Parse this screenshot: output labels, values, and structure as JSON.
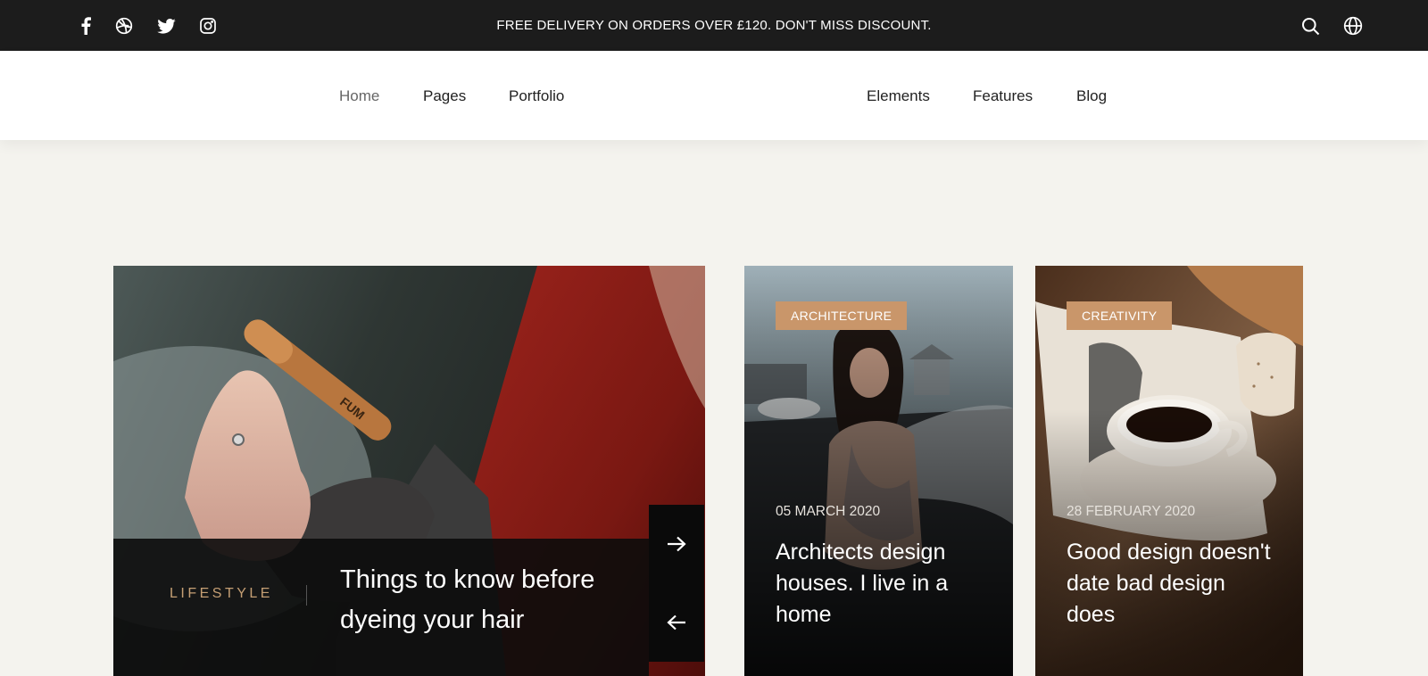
{
  "topbar": {
    "promo": "FREE DELIVERY ON ORDERS OVER £120. DON'T MISS DISCOUNT.",
    "social_icons": [
      "facebook-icon",
      "dribbble-icon",
      "twitter-icon",
      "instagram-icon"
    ],
    "tool_icons": [
      "search-icon",
      "globe-icon"
    ],
    "background": "#1c1c1c"
  },
  "nav": {
    "left": [
      "Home",
      "Pages",
      "Portfolio"
    ],
    "right": [
      "Elements",
      "Features",
      "Blog"
    ],
    "active": "Home"
  },
  "featured": {
    "category": "LIFESTYLE",
    "title": "Things to know before dyeing your hair"
  },
  "posts": [
    {
      "category": "ARCHITECTURE",
      "date": "05 MARCH 2020",
      "title": "Architects design houses. I live in a home"
    },
    {
      "category": "CREATIVITY",
      "date": "28 FEBRUARY 2020",
      "title": "Good design doesn't date bad design does"
    }
  ],
  "colors": {
    "accent": "#c9966a",
    "page_background": "#f4f3ee",
    "category_text": "#c59f74"
  }
}
